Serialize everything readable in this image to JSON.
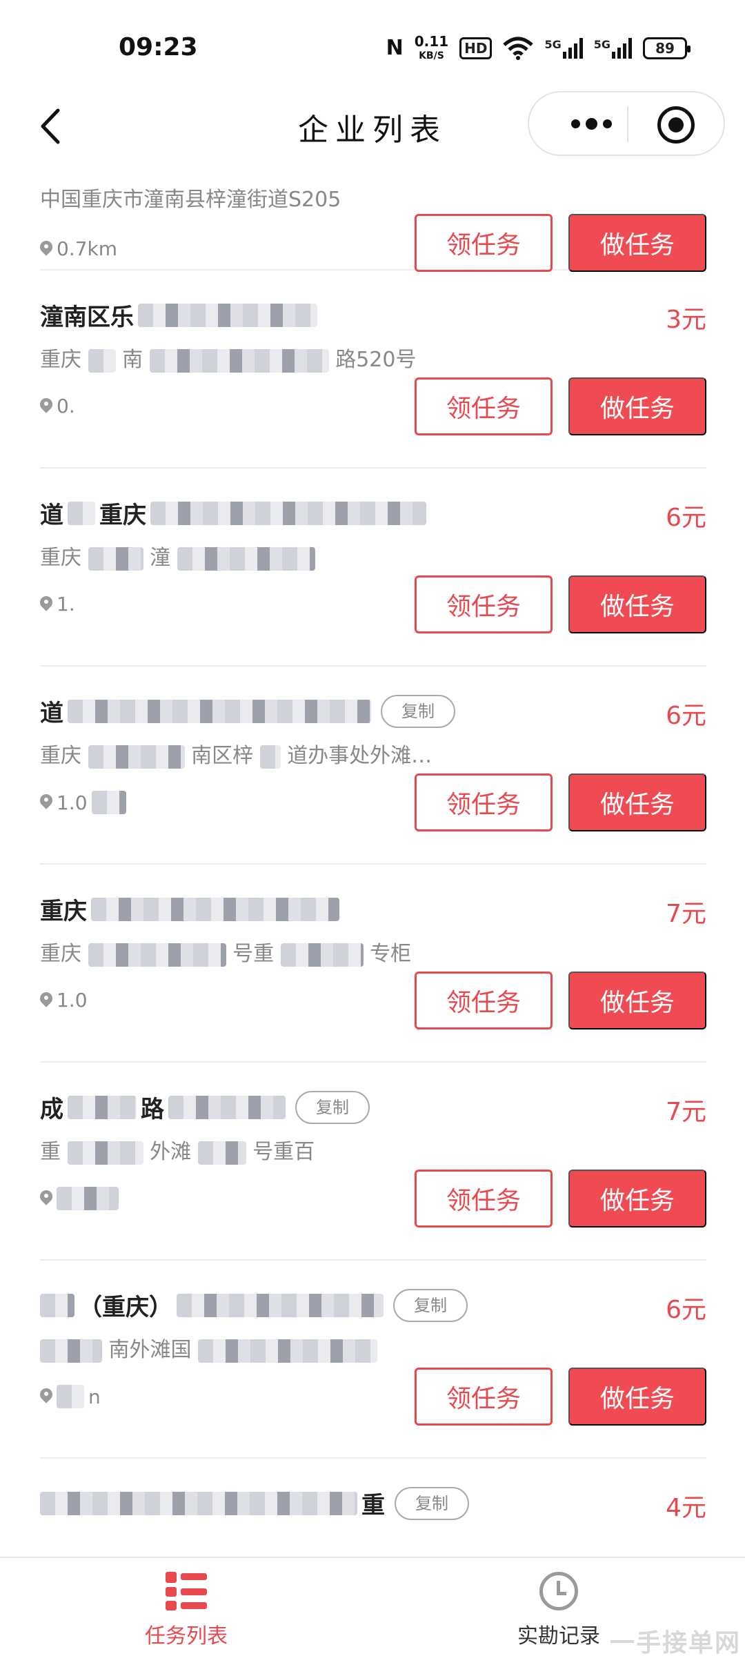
{
  "status_bar": {
    "time": "09:23",
    "nfc": "N",
    "speed_value": "0.11",
    "speed_unit": "KB/S",
    "hd": "HD",
    "sim1": "5G",
    "sim2": "5G",
    "battery": "89"
  },
  "nav": {
    "title": "企业列表",
    "icons": [
      "back-icon",
      "more-icon",
      "close-icon"
    ]
  },
  "buttons": {
    "claim": "领任务",
    "do": "做任务"
  },
  "first_item": {
    "address": "中国重庆市潼南县梓潼街道S205",
    "distance": "0.7km"
  },
  "items": [
    {
      "name": "潼南区乐",
      "copy": "",
      "price": "3元",
      "address_start": "重庆",
      "address_mid": "南",
      "address_end": "路520号",
      "distance": "0."
    },
    {
      "name": "道",
      "name_mid": "重庆",
      "copy": "",
      "price": "6元",
      "address_start": "重庆",
      "address_mid": "潼",
      "address_end": "",
      "distance": "1."
    },
    {
      "name": "道",
      "name_mid": "",
      "copy": "复制",
      "price": "6元",
      "address_start": "重庆",
      "address_mid": "南区梓",
      "address_end": "道办事处外滩…",
      "distance": "1.0"
    },
    {
      "name": "重庆",
      "name_mid": "",
      "copy": "",
      "price": "7元",
      "address_start": "重庆",
      "address_mid": "号重",
      "address_end": "专柜",
      "distance": "1.0"
    },
    {
      "name": "成",
      "name_mid": "路",
      "copy": "复制",
      "price": "7元",
      "address_start": "重",
      "address_mid": "外滩",
      "address_end": "号重百",
      "distance": ""
    },
    {
      "name": "（重庆）",
      "name_mid": "",
      "copy": "复制",
      "price": "6元",
      "address_start": "",
      "address_mid": "南外滩国",
      "address_end": "",
      "distance": "n"
    },
    {
      "name": "",
      "name_mid": "重",
      "copy": "复制",
      "price": "4元",
      "address_start": "",
      "address_mid": "",
      "address_end": "",
      "distance": ""
    }
  ],
  "tabs": [
    {
      "label": "任务列表",
      "icon": "list-icon",
      "active": true
    },
    {
      "label": "实勘记录",
      "icon": "history-icon",
      "active": false
    }
  ],
  "watermark": "一手接单网",
  "colors": {
    "accent": "#e8494f",
    "button_fill": "#f04a52",
    "muted_text": "#888888"
  }
}
